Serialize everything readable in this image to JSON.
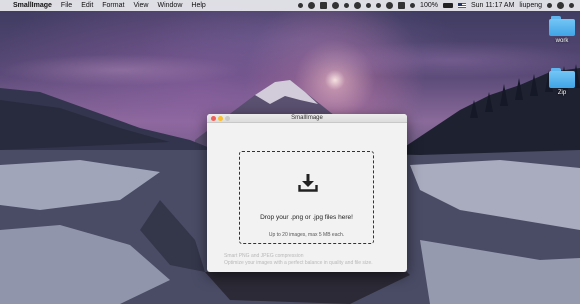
{
  "menubar": {
    "app_name": "SmallImage",
    "items": [
      "File",
      "Edit",
      "Format",
      "View",
      "Window",
      "Help"
    ],
    "battery": "100%",
    "clock": "Sun 11:17 AM",
    "user": "liupeng"
  },
  "desktop": {
    "folders": [
      {
        "label": "work"
      },
      {
        "label": "Zip"
      }
    ]
  },
  "window": {
    "title": "SmallImage",
    "drop_title": "Drop your .png or .jpg files here!",
    "drop_limit": "Up to 20 images, max 5 MB each.",
    "footer_line1": "Smart PNG and JPEG compression",
    "footer_line2": "Optimize your images with a perfect balance in quality and file size."
  },
  "colors": {
    "folder_blue": "#4aaeee",
    "close": "#f25f58",
    "minimize": "#fbbe2e"
  }
}
